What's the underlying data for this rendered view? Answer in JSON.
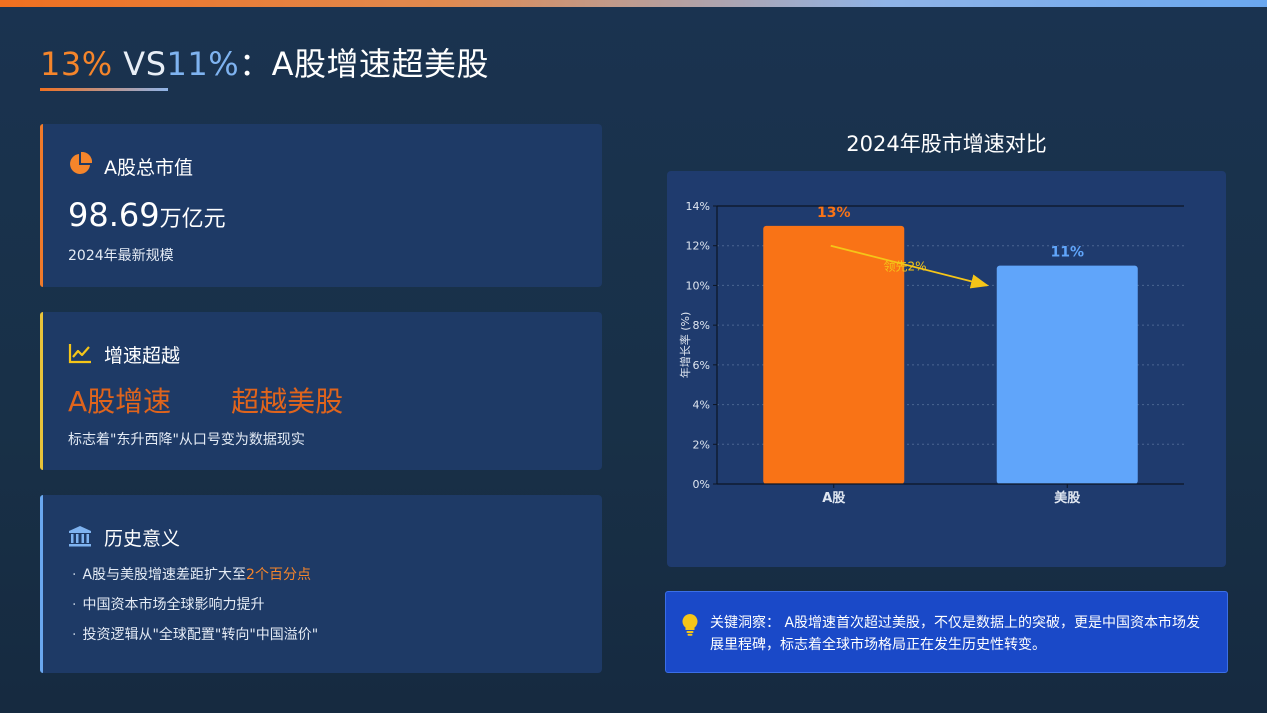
{
  "header": {
    "title_a": "13%",
    "title_vs": " VS",
    "title_b": "11%",
    "title_rest": "：A股增速超美股"
  },
  "cards": {
    "market_cap": {
      "label": "A股总市值",
      "value": "98.69",
      "unit": "万亿元",
      "sub": "2024年最新规模",
      "icon": "pie-chart-icon"
    },
    "growth": {
      "label": "增速超越",
      "highlight_left": "A股增速",
      "highlight_right": "超越美股",
      "sub": "标志着\"东升西降\"从口号变为数据现实",
      "icon": "line-chart-icon"
    },
    "history": {
      "label": "历史意义",
      "icon": "bank-icon",
      "bullet1_prefix": "A股与美股增速差距扩大至",
      "bullet1_highlight": "2个百分点",
      "bullet2": "中国资本市场全球影响力提升",
      "bullet3": "投资逻辑从\"全球配置\"转向\"中国溢价\""
    }
  },
  "chart_title": "2024年股市增速对比",
  "chart_data": {
    "type": "bar",
    "categories": [
      "A股",
      "美股"
    ],
    "values": [
      13,
      11
    ],
    "value_labels": [
      "13%",
      "11%"
    ],
    "ylabel": "年增长率 (%)",
    "ylim": [
      0,
      14
    ],
    "yticks": [
      0,
      2,
      4,
      6,
      8,
      10,
      12,
      14
    ],
    "ytick_labels": [
      "0%",
      "2%",
      "4%",
      "6%",
      "8%",
      "10%",
      "12%",
      "14%"
    ],
    "grid": true,
    "annotation": "领先2%",
    "colors": [
      "#f97316",
      "#60a5fa"
    ],
    "label_colors": [
      "#f97316",
      "#60a5fa"
    ],
    "arrow_color": "#f5c518"
  },
  "insight": {
    "label": "关键洞察：",
    "text": "A股增速首次超过美股，不仅是数据上的突破，更是中国资本市场发展里程碑，标志着全球市场格局正在发生历史性转变。",
    "icon": "lightbulb-icon"
  }
}
